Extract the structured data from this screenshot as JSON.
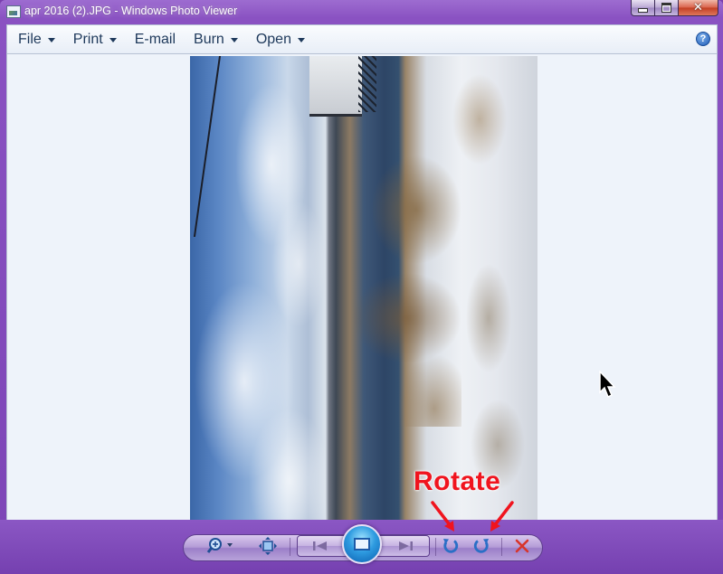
{
  "window": {
    "title": "apr 2016 (2).JPG - Windows Photo Viewer",
    "close_glyph": "✕"
  },
  "menu": {
    "items": [
      {
        "label": "File",
        "has_dropdown": true
      },
      {
        "label": "Print",
        "has_dropdown": true
      },
      {
        "label": "E-mail",
        "has_dropdown": false
      },
      {
        "label": "Burn",
        "has_dropdown": true
      },
      {
        "label": "Open",
        "has_dropdown": true
      }
    ],
    "help_label": "?"
  },
  "annotation": {
    "label": "Rotate",
    "color": "#f0141e"
  },
  "toolbar": {
    "buttons": [
      "zoom-icon",
      "actual-size-icon",
      "previous-icon",
      "slideshow-icon",
      "next-icon",
      "rotate-counterclockwise-icon",
      "rotate-clockwise-icon",
      "delete-icon"
    ]
  },
  "colors": {
    "frame": "#7c44b6",
    "menu_text": "#1e395b",
    "viewer_bg": "#eef3fa",
    "delete_red": "#d8342a",
    "rotate_blue": "#2a6fc6"
  }
}
